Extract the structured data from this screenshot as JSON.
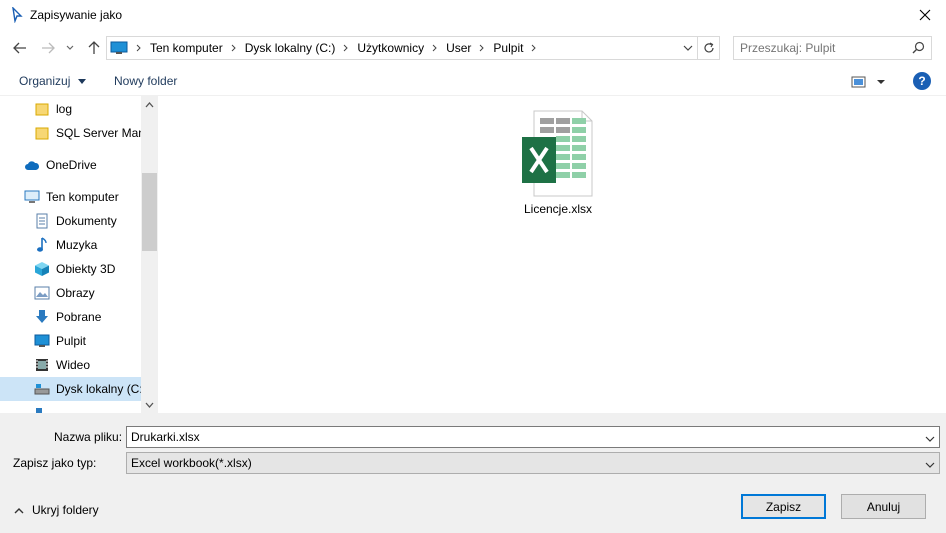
{
  "window": {
    "title": "Zapisywanie jako"
  },
  "nav": {
    "breadcrumbs": [
      "Ten komputer",
      "Dysk lokalny (C:)",
      "Użytkownicy",
      "User",
      "Pulpit"
    ],
    "search_placeholder": "Przeszukaj: Pulpit"
  },
  "toolbar": {
    "organize_label": "Organizuj",
    "new_folder_label": "Nowy folder",
    "help_label": "?"
  },
  "sidebar": {
    "items": [
      {
        "label": "log",
        "icon": "folder-icon"
      },
      {
        "label": "SQL Server Management",
        "icon": "folder-icon"
      },
      {
        "label": "OneDrive",
        "icon": "cloud-icon"
      },
      {
        "label": "Ten komputer",
        "icon": "computer-icon"
      },
      {
        "label": "Dokumenty",
        "icon": "documents-icon"
      },
      {
        "label": "Muzyka",
        "icon": "music-icon"
      },
      {
        "label": "Obiekty 3D",
        "icon": "cube-3d-icon"
      },
      {
        "label": "Obrazy",
        "icon": "pictures-icon"
      },
      {
        "label": "Pobrane",
        "icon": "download-icon"
      },
      {
        "label": "Pulpit",
        "icon": "desktop-icon"
      },
      {
        "label": "Wideo",
        "icon": "video-icon"
      },
      {
        "label": "Dysk lokalny (C:)",
        "icon": "drive-icon"
      }
    ]
  },
  "content": {
    "files": [
      {
        "name": "Licencje.xlsx",
        "icon": "excel-file-icon"
      }
    ]
  },
  "form": {
    "filename_label": "Nazwa pliku:",
    "filename_value": "Drukarki.xlsx",
    "type_label": "Zapisz jako typ:",
    "type_value": "Excel workbook(*.xlsx)",
    "hide_folders_label": "Ukryj foldery",
    "save_label": "Zapisz",
    "cancel_label": "Anuluj"
  },
  "colors": {
    "accent": "#0078d7",
    "selected_bg": "#cce4f7",
    "excel_green": "#1e7145"
  }
}
